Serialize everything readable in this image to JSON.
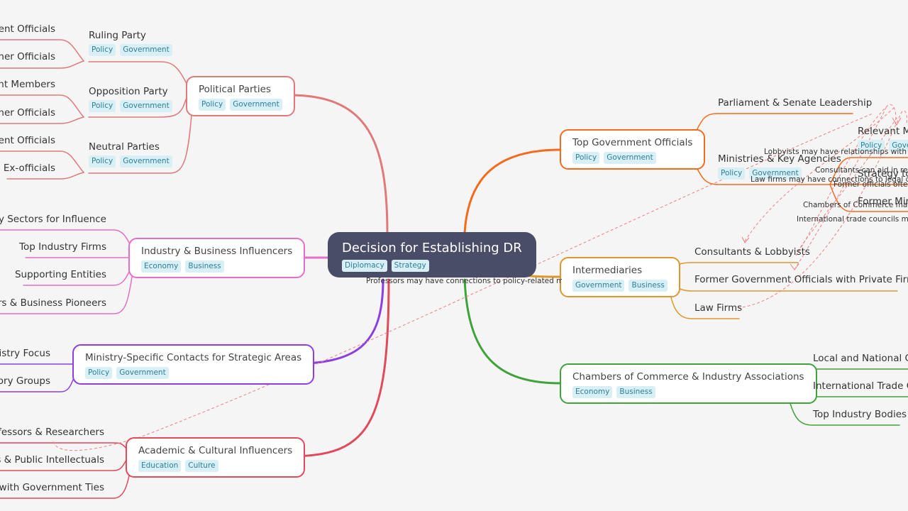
{
  "root": {
    "title": "Decision for Establishing DR",
    "tags": [
      "Diplomacy",
      "Strategy"
    ]
  },
  "colors": {
    "political": "#e07a7a",
    "industry": "#e56fc8",
    "ministry": "#8b3fe0",
    "academic": "#e04a5a",
    "government": "#f36b1c",
    "intermediaries": "#e0962c",
    "chambers": "#3fa33a",
    "relation": "#f08080"
  },
  "left": {
    "political": {
      "title": "Political Parties",
      "tags": [
        "Policy",
        "Government"
      ],
      "children": [
        {
          "title": "Ruling Party",
          "tags": [
            "Policy",
            "Government"
          ],
          "leaves": [
            "Current Officials",
            "Former Officials"
          ]
        },
        {
          "title": "Opposition Party",
          "tags": [
            "Policy",
            "Government"
          ],
          "leaves": [
            "Parliament Members",
            "Former Officials"
          ]
        },
        {
          "title": "Neutral Parties",
          "tags": [
            "Policy",
            "Government"
          ],
          "leaves": [
            "Independent Officials",
            "Ex-officials"
          ]
        }
      ]
    },
    "industry": {
      "title": "Industry & Business Influencers",
      "tags": [
        "Economy",
        "Business"
      ],
      "leaves": [
        "Key Sectors for Influence",
        "Top Industry Firms",
        "Supporting Entities",
        "Entrepreneurs & Business Pioneers"
      ]
    },
    "ministry": {
      "title": "Ministry-Specific Contacts for Strategic Areas",
      "tags": [
        "Policy",
        "Government"
      ],
      "leaves": [
        "Ministry Focus",
        "Advisory Groups"
      ]
    },
    "academic": {
      "title": "Academic & Cultural Influencers",
      "tags": [
        "Education",
        "Culture"
      ],
      "leaves": [
        "Professors & Researchers",
        "Writers & Public Intellectuals",
        "Advisors with Government Ties"
      ]
    }
  },
  "right": {
    "government": {
      "title": "Top Government Officials",
      "tags": [
        "Policy",
        "Government"
      ],
      "leaves": [
        "Parliament & Senate Leadership"
      ],
      "ministries": {
        "title": "Ministries & Key Agencies",
        "tags": [
          "Policy",
          "Government"
        ],
        "children": [
          {
            "title": "Relevant Ministries",
            "tags": [
              "Policy",
              "Government"
            ]
          },
          {
            "title": "Strategy to Reach"
          },
          {
            "title": "Former Ministers"
          }
        ]
      }
    },
    "intermediaries": {
      "title": "Intermediaries",
      "tags": [
        "Government",
        "Business"
      ],
      "leaves": [
        "Consultants & Lobbyists",
        "Former Government Officials with Private Firms",
        "Law Firms"
      ]
    },
    "chambers": {
      "title": "Chambers of Commerce & Industry Associations",
      "tags": [
        "Economy",
        "Business"
      ],
      "leaves": [
        "Local and National Chambers",
        "International Trade Councils",
        "Top Industry Bodies"
      ]
    }
  },
  "relationship_notes": [
    "Professors may have connections to policy-related ministries",
    "Lobbyists may have relationships with relevant ministries",
    "Consultants can aid in reaching",
    "Law firms may have connections to legal departments",
    "Former officials often",
    "Chambers of Commerce may",
    "International trade councils may"
  ]
}
